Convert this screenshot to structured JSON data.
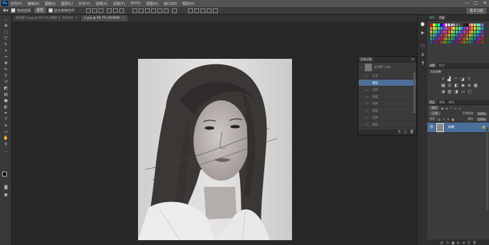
{
  "app": {
    "logo": "Ps"
  },
  "menu": [
    "文件(F)",
    "编辑(E)",
    "图像(I)",
    "图层(L)",
    "文字(Y)",
    "选择(S)",
    "滤镜(T)",
    "3D(D)",
    "视图(V)",
    "窗口(W)",
    "帮助(H)"
  ],
  "window_controls": [
    "—",
    "□",
    "✕"
  ],
  "options": {
    "tool_icon": "move-tool",
    "auto_select_label": "自动选择:",
    "auto_select_value": "图层",
    "show_transform_label": "显示变换控件",
    "workspace_label": "基本功能"
  },
  "tabs": [
    {
      "label": "未标题-1.jpg @ 66.7% (图层 1, RGB/8)",
      "active": false
    },
    {
      "label": "1.jpg @ 66.7% (RGB/8)",
      "active": true
    }
  ],
  "history_panel": {
    "title": "历史记录",
    "snapshot_label": "未标题-1.jpg",
    "states": [
      {
        "label": "打开",
        "active": false
      },
      {
        "label": "图层",
        "active": true
      },
      {
        "label": "选择",
        "active": false
      },
      {
        "label": "图层",
        "active": false
      },
      {
        "label": "选择",
        "active": false
      },
      {
        "label": "图层",
        "active": false
      },
      {
        "label": "选择",
        "active": false
      },
      {
        "label": "图层",
        "active": false
      },
      {
        "label": "选择",
        "active": false
      }
    ]
  },
  "swatches_panel": {
    "tabs": [
      "颜色",
      "色板"
    ]
  },
  "adjustments_panel": {
    "tabs": [
      "调整",
      "样式"
    ],
    "subtitle": "添加调整"
  },
  "layers_panel": {
    "tabs": [
      "图层",
      "通道",
      "路径"
    ],
    "filter_label": "类型",
    "blend_mode": "正常",
    "opacity_label": "不透明度:",
    "opacity_value": "100%",
    "lock_label": "锁定:",
    "fill_label": "填充:",
    "fill_value": "100%",
    "layer_name": "背景"
  },
  "colors": {
    "selection_blue": "#4b6f99",
    "panel_bg": "#3b3b3b",
    "canvas_bg": "#282828",
    "menubar_bg": "#535353"
  }
}
